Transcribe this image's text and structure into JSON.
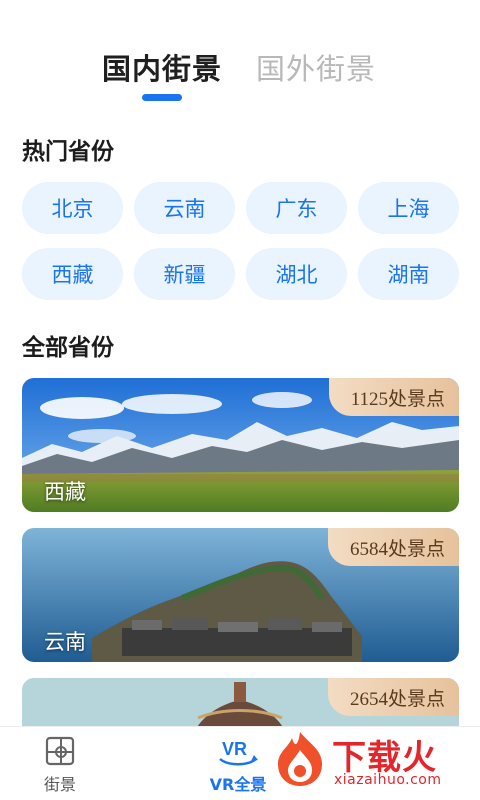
{
  "tabs": [
    {
      "label": "国内街景",
      "active": true
    },
    {
      "label": "国外街景",
      "active": false
    }
  ],
  "hot_section": {
    "title": "热门省份"
  },
  "hot_provinces": [
    "北京",
    "云南",
    "广东",
    "上海",
    "西藏",
    "新疆",
    "湖北",
    "湖南"
  ],
  "all_section": {
    "title": "全部省份"
  },
  "cards": [
    {
      "name": "西藏",
      "count": "1125处景点"
    },
    {
      "name": "云南",
      "count": "6584处景点"
    },
    {
      "name": "",
      "count": "2654处景点"
    }
  ],
  "bottom_nav": [
    {
      "label": "街景",
      "icon": "street-view-icon",
      "active": false
    },
    {
      "label": "VR全景",
      "icon": "vr-icon",
      "active": true
    }
  ],
  "watermark": {
    "text": "下载火",
    "url": "xiazaihuo.com"
  },
  "colors": {
    "accent": "#1a74f0",
    "chip_bg": "#eaf4ff",
    "badge_gold": "#e6c29c",
    "watermark_red": "#e3262c"
  }
}
